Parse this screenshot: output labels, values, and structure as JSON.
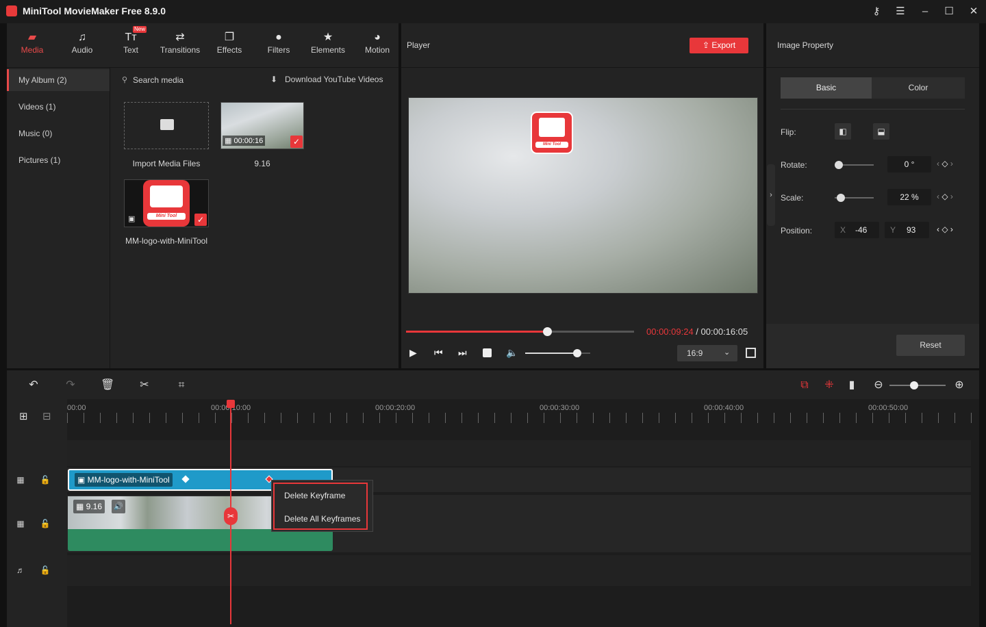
{
  "app": {
    "title": "MiniTool MovieMaker Free 8.9.0"
  },
  "toolbar": {
    "tabs": [
      {
        "label": "Media",
        "icon": "media-folder-icon"
      },
      {
        "label": "Audio",
        "icon": "music-note-icon"
      },
      {
        "label": "Text",
        "icon": "text-icon"
      },
      {
        "label": "Transitions",
        "icon": "transitions-icon"
      },
      {
        "label": "Effects",
        "icon": "effects-icon"
      },
      {
        "label": "Filters",
        "icon": "filters-icon"
      },
      {
        "label": "Elements",
        "icon": "elements-icon"
      },
      {
        "label": "Motion",
        "icon": "motion-icon"
      }
    ],
    "new_badge": "New"
  },
  "sidebar": {
    "items": [
      {
        "label": "My Album (2)"
      },
      {
        "label": "Videos (1)"
      },
      {
        "label": "Music (0)"
      },
      {
        "label": "Pictures (1)"
      }
    ]
  },
  "media": {
    "search_placeholder": "Search media",
    "download_label": "Download YouTube Videos",
    "import_label": "Import Media Files",
    "video_duration": "00:00:16",
    "video_name": "9.16",
    "image_name": "MM-logo-with-MiniTool",
    "logo_text": "Mini Tool"
  },
  "player": {
    "title": "Player",
    "export_label": "Export",
    "current_time": "00:00:09:24",
    "separator": " / ",
    "total_time": "00:00:16:05",
    "aspect": "16:9",
    "progress": 0.62,
    "volume": 0.8
  },
  "property": {
    "title": "Image Property",
    "tabs": [
      "Basic",
      "Color"
    ],
    "flip_label": "Flip:",
    "rotate_label": "Rotate:",
    "rotate_value": "0 °",
    "scale_label": "Scale:",
    "scale_value": "22 %",
    "position_label": "Position:",
    "x_label": "X",
    "x_value": "-46",
    "y_label": "Y",
    "y_value": "93",
    "reset_label": "Reset"
  },
  "timeline": {
    "ruler": [
      "00:00",
      "00:00:10:00",
      "00:00:20:00",
      "00:00:30:00",
      "00:00:40:00",
      "00:00:50:00"
    ],
    "image_clip_label": "MM-logo-with-MiniTool",
    "video_clip_label": "9.16",
    "context_menu": [
      "Delete Keyframe",
      "Delete All Keyframes"
    ]
  },
  "colors": {
    "accent": "#e8373a",
    "image_clip": "#1f9ac9",
    "video_clip": "#2e8b60"
  }
}
